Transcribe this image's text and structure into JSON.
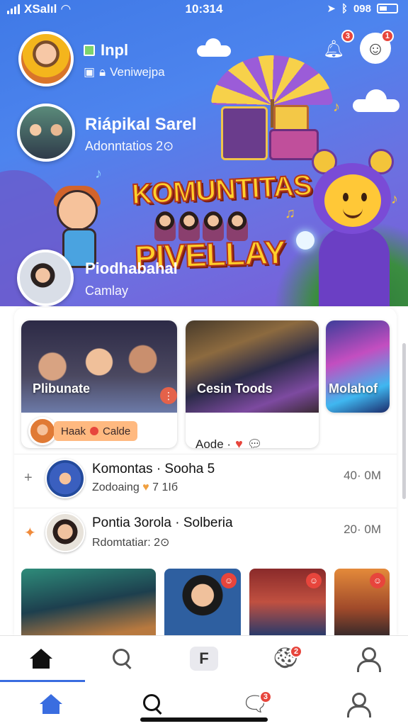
{
  "status_bar": {
    "carrier": "XSalıl",
    "time": "10:314",
    "battery_text": "098"
  },
  "colors": {
    "accent": "#3a6de0",
    "badge": "#e7453c",
    "hero_start": "#3f79e6",
    "hero_end": "#7b5ad6"
  },
  "header": {
    "notification_badge": "3",
    "profile_badge": "1",
    "notification_icon": "bell-icon",
    "profile_icon": "smiley-icon"
  },
  "hero": {
    "logo_line1": "KOMUNTITAS",
    "logo_line2": "PIVELLAY",
    "stories": [
      {
        "title": "Inpl",
        "subtitle": "Veniwejpa"
      },
      {
        "title": "Riápikal Sarel",
        "subtitle": "Adonntatios 2⊙"
      },
      {
        "title": "Piodhabahal",
        "subtitle": "Camlay"
      }
    ]
  },
  "cards": [
    {
      "caption": "Plibunate",
      "chip": "Haak",
      "chip_tail": "Calde"
    },
    {
      "caption": "Cesin Toods",
      "meta": "Aode ·"
    },
    {
      "caption": "Molahof"
    }
  ],
  "rows": [
    {
      "prefix": "+",
      "title": "Komontas · Sooha 5",
      "subtitle": "Zodoaing",
      "subtitle_tail": "7 1Iб",
      "time": "40· 0M"
    },
    {
      "prefix": "✦",
      "title": "Pontia 3orola · Solberia",
      "subtitle": "Rdomtatiar: 2⊙",
      "time": "20· 0M"
    }
  ],
  "thumb_badges": [
    "",
    "",
    "",
    ""
  ],
  "tabbar_top": {
    "tabs": [
      {
        "name": "home",
        "icon": "home-icon"
      },
      {
        "name": "search",
        "icon": "search-icon"
      },
      {
        "name": "create",
        "icon": "create-icon",
        "label": "F"
      },
      {
        "name": "activity",
        "icon": "cookie-icon",
        "badge": "2"
      },
      {
        "name": "profile",
        "icon": "user-icon"
      }
    ]
  },
  "tabbar_bottom": {
    "tabs": [
      {
        "name": "home",
        "icon": "home-icon"
      },
      {
        "name": "search",
        "icon": "search-icon"
      },
      {
        "name": "messages",
        "icon": "chat-icon",
        "badge": "3"
      },
      {
        "name": "profile",
        "icon": "user-icon"
      }
    ]
  }
}
